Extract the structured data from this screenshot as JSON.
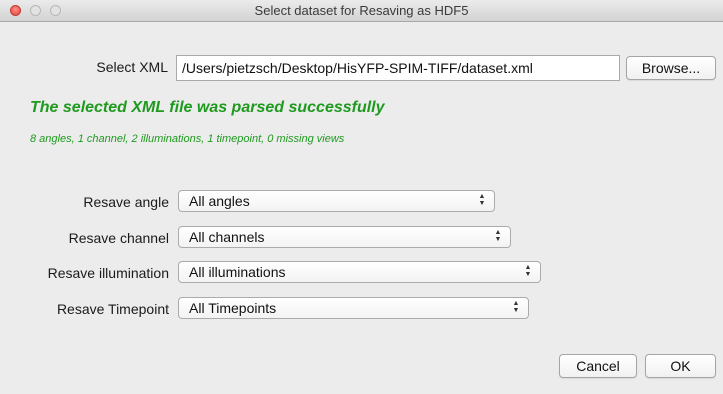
{
  "window": {
    "title": "Select dataset for Resaving as HDF5"
  },
  "xml": {
    "label": "Select XML",
    "path": "/Users/pietzsch/Desktop/HisYFP-SPIM-TIFF/dataset.xml",
    "browse_label": "Browse..."
  },
  "status": {
    "title": "The selected XML file was parsed successfully",
    "details": "8 angles, 1 channel, 2 illuminations, 1 timepoint, 0 missing views",
    "color": "#1f9a1f"
  },
  "options": {
    "angle": {
      "label": "Resave angle",
      "value": "All angles"
    },
    "channel": {
      "label": "Resave channel",
      "value": "All channels"
    },
    "illumination": {
      "label": "Resave illumination",
      "value": "All illuminations"
    },
    "timepoint": {
      "label": "Resave Timepoint",
      "value": "All Timepoints"
    }
  },
  "buttons": {
    "cancel_label": "Cancel",
    "ok_label": "OK"
  },
  "icons": {
    "close": "close-icon",
    "minimize": "minimize-icon",
    "zoom": "zoom-icon",
    "select": "updown-arrows-icon"
  }
}
